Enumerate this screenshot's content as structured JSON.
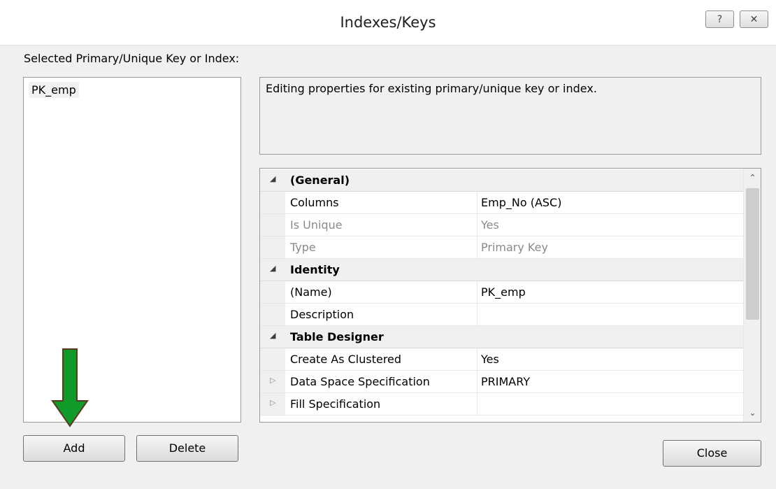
{
  "window": {
    "title": "Indexes/Keys",
    "help_glyph": "?",
    "close_glyph": "✕"
  },
  "selected_label": "Selected Primary/Unique Key or Index:",
  "keys_list": [
    {
      "label": "PK_emp"
    }
  ],
  "description": "Editing properties for existing primary/unique key or index.",
  "properties": [
    {
      "type": "category",
      "expander": "◢",
      "name": "(General)"
    },
    {
      "type": "property",
      "name": "Columns",
      "value": "Emp_No (ASC)",
      "disabled": false
    },
    {
      "type": "property",
      "name": "Is Unique",
      "value": "Yes",
      "disabled": true
    },
    {
      "type": "property",
      "name": "Type",
      "value": "Primary Key",
      "disabled": true
    },
    {
      "type": "category",
      "expander": "◢",
      "name": "Identity"
    },
    {
      "type": "property",
      "name": "(Name)",
      "value": "PK_emp",
      "disabled": false
    },
    {
      "type": "property",
      "name": "Description",
      "value": "",
      "disabled": false
    },
    {
      "type": "category",
      "expander": "◢",
      "name": "Table Designer"
    },
    {
      "type": "property",
      "name": "Create As Clustered",
      "value": "Yes",
      "disabled": false
    },
    {
      "type": "property",
      "expander": "▷",
      "name": "Data Space Specification",
      "value": "PRIMARY",
      "disabled": false
    },
    {
      "type": "property",
      "expander": "▷",
      "name": "Fill Specification",
      "value": "",
      "disabled": false
    }
  ],
  "scroll_up_glyph": "⌃",
  "scroll_down_glyph": "⌄",
  "buttons": {
    "add": "Add",
    "delete": "Delete",
    "close": "Close"
  },
  "annotation": {
    "arrow_color": "#0f9a2a",
    "arrow_outline": "#5a3a1e"
  }
}
